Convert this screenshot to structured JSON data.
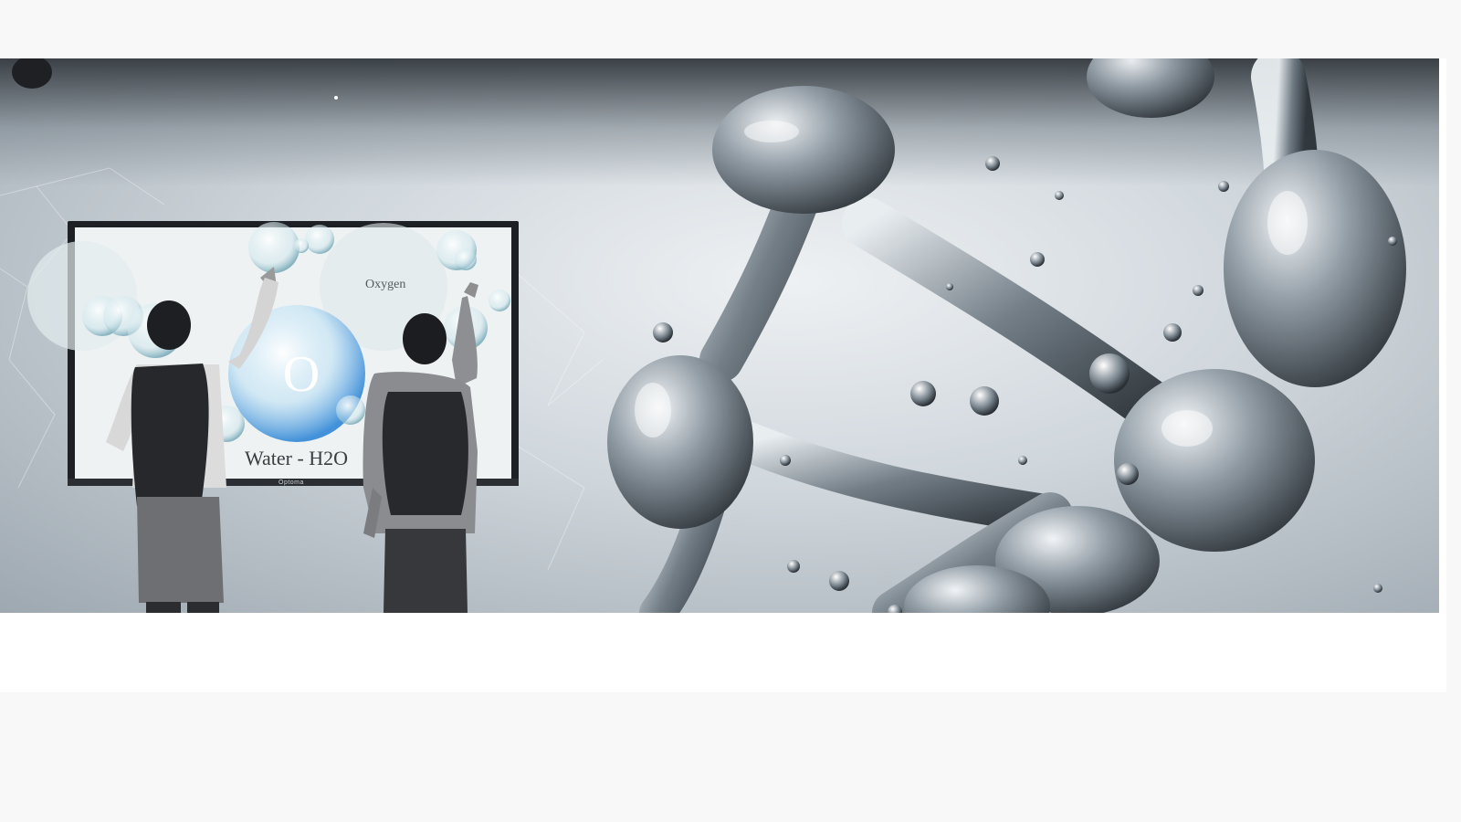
{
  "hero": {
    "screen_caption": "Water - H2O",
    "bubble_label": "Oxygen",
    "bubble_letter": "O",
    "brand_mark": "Optoma"
  },
  "icons": {
    "molecule": "water-molecule-illustration",
    "display": "interactive-flat-panel-display"
  },
  "colors": {
    "background": "#f8f8f8",
    "band": "#ffffff",
    "bubble_blue": "#2f86d6",
    "steel": "#5c6770"
  }
}
